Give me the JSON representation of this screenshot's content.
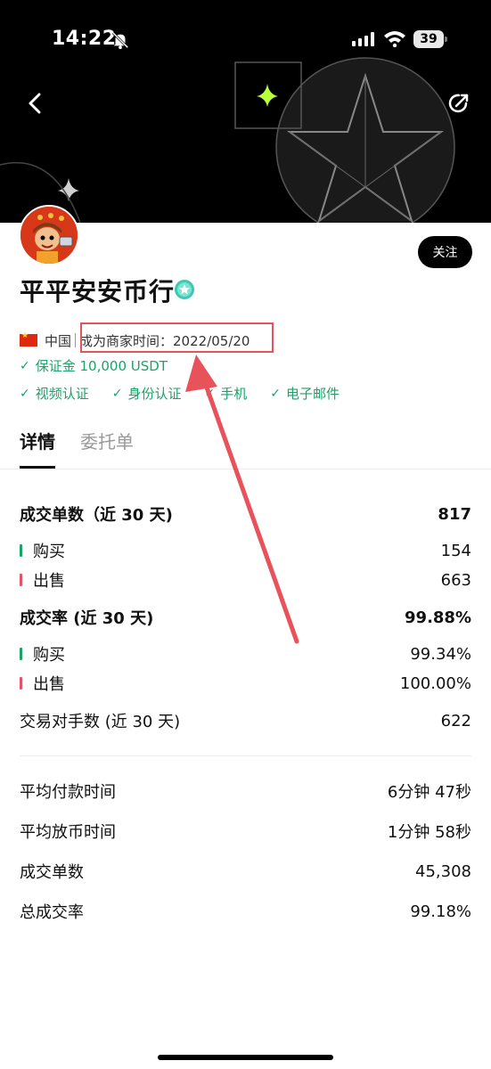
{
  "status_bar": {
    "time": "14:22",
    "battery": "39",
    "icons": [
      "bell-off-icon",
      "signal-icon",
      "wifi-icon",
      "battery-icon"
    ]
  },
  "header": {
    "back_icon": "chevron-left-icon",
    "share_icon": "share-icon"
  },
  "profile": {
    "name": "平平安安币行",
    "follow_label": "关注",
    "country": "中国",
    "merchant_since": "成为商家时间：2022/05/20",
    "deposit": "保证金 10,000 USDT",
    "verifications": [
      "视频认证",
      "身份认证",
      "手机",
      "电子邮件"
    ]
  },
  "tabs": [
    {
      "label": "详情",
      "active": true
    },
    {
      "label": "委托单",
      "active": false
    }
  ],
  "stats": {
    "orders_30d": {
      "label": "成交单数（近 30 天)",
      "value": "817"
    },
    "orders_buy": {
      "label": "购买",
      "value": "154"
    },
    "orders_sell": {
      "label": "出售",
      "value": "663"
    },
    "rate_30d": {
      "label": "成交率 (近 30 天)",
      "value": "99.88%"
    },
    "rate_buy": {
      "label": "购买",
      "value": "99.34%"
    },
    "rate_sell": {
      "label": "出售",
      "value": "100.00%"
    },
    "counterparties": {
      "label": "交易对手数 (近 30 天)",
      "value": "622"
    }
  },
  "summary": {
    "avg_pay": {
      "label": "平均付款时间",
      "value": "6分钟 47秒"
    },
    "avg_release": {
      "label": "平均放币时间",
      "value": "1分钟 58秒"
    },
    "total_orders": {
      "label": "成交单数",
      "value": "45,308"
    },
    "total_rate": {
      "label": "总成交率",
      "value": "99.18%"
    }
  },
  "colors": {
    "accent_green": "#1aa36a",
    "sell_red": "#e05566",
    "annotation_red": "#e8525a",
    "banner_bg": "#000000"
  }
}
